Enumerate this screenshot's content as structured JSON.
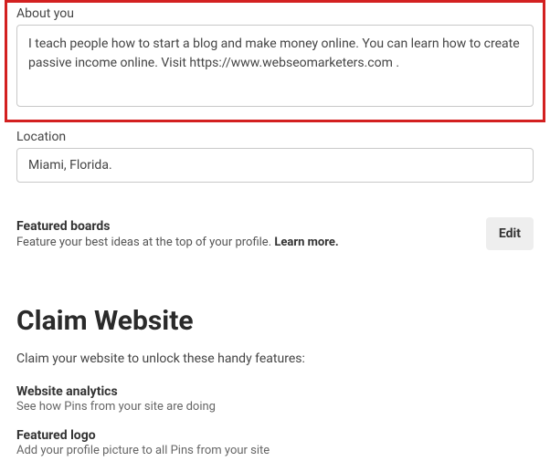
{
  "about": {
    "label": "About you",
    "value": "I teach people how to start a blog and make money online. You can learn how to create passive income online. Visit https://www.webseomarketers.com ."
  },
  "location": {
    "label": "Location",
    "value": "Miami, Florida."
  },
  "featured": {
    "title": "Featured boards",
    "subPrefix": "Feature your best ideas at the top of your profile. ",
    "learnMore": "Learn more.",
    "editLabel": "Edit"
  },
  "claim": {
    "heading": "Claim Website",
    "desc": "Claim your website to unlock these handy features:",
    "features": [
      {
        "title": "Website analytics",
        "desc": "See how Pins from your site are doing"
      },
      {
        "title": "Featured logo",
        "desc": "Add your profile picture to all Pins from your site"
      }
    ]
  }
}
